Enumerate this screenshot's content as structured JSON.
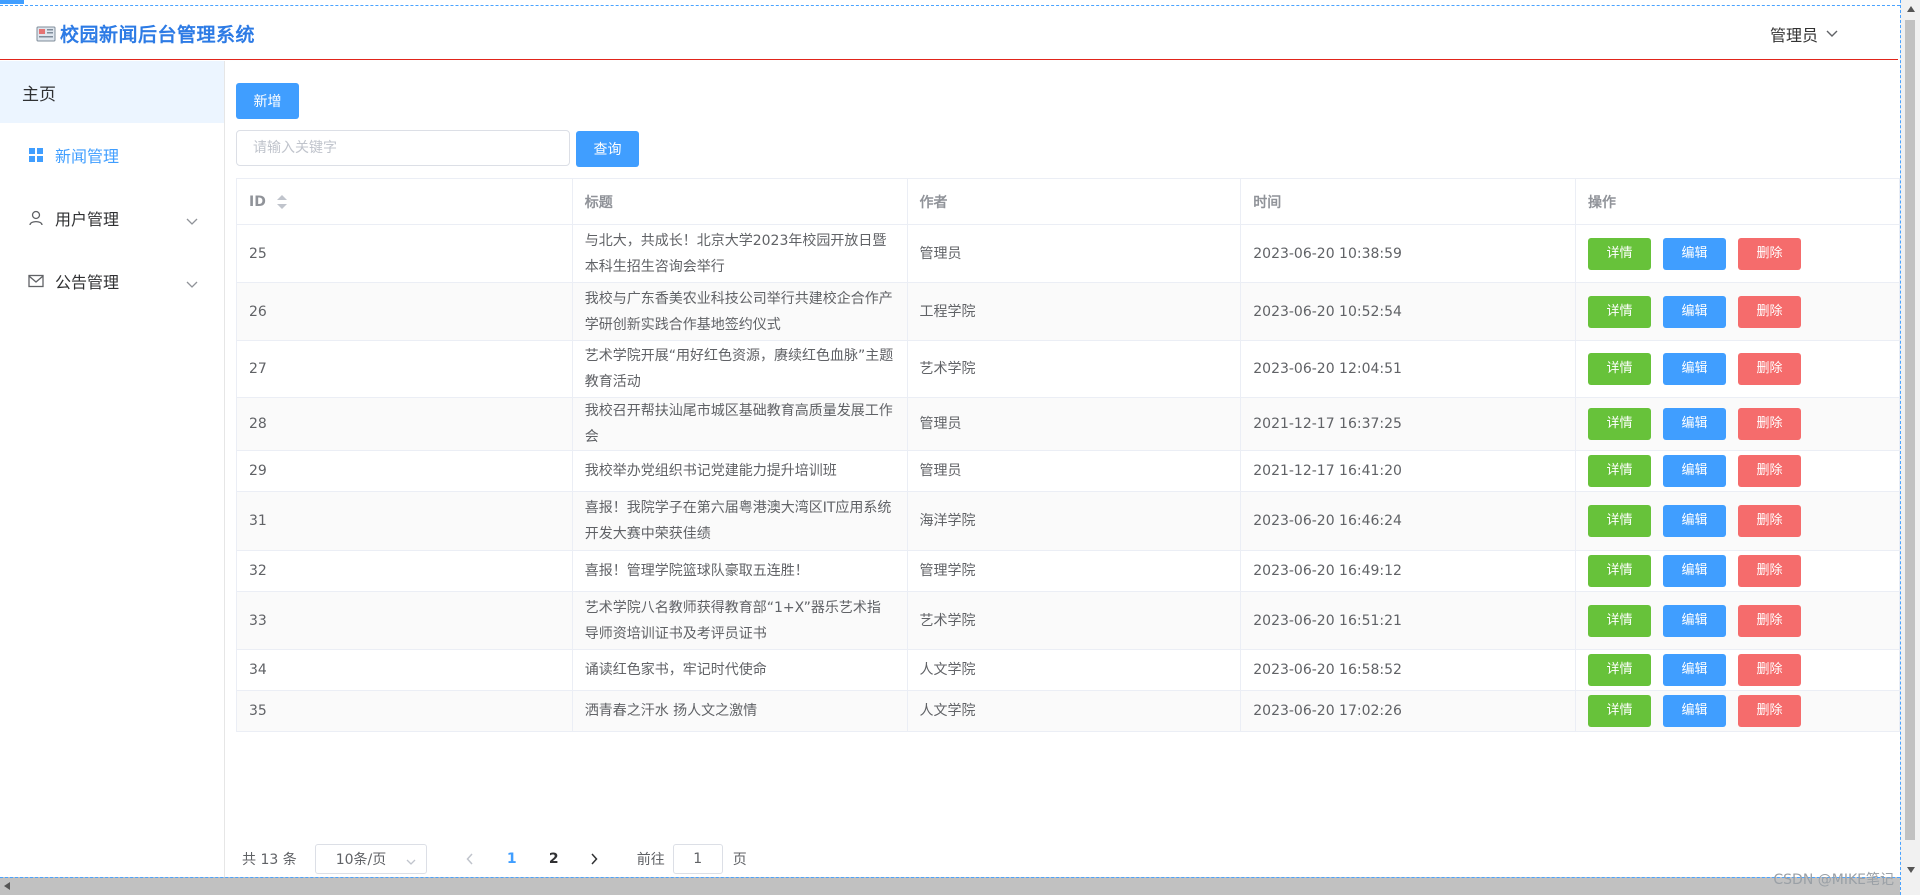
{
  "header": {
    "title": "校园新闻后台管理系统",
    "user": "管理员"
  },
  "sidebar": {
    "home": "主页",
    "items": [
      {
        "label": "新闻管理",
        "icon": "grid-icon",
        "active": true
      },
      {
        "label": "用户管理",
        "icon": "user-icon",
        "active": false
      },
      {
        "label": "公告管理",
        "icon": "mail-icon",
        "active": false
      }
    ]
  },
  "toolbar": {
    "add_label": "新增",
    "search_placeholder": "请输入关键字",
    "query_label": "查询"
  },
  "table": {
    "columns": [
      "ID",
      "标题",
      "作者",
      "时间",
      "操作"
    ],
    "action_labels": {
      "detail": "详情",
      "edit": "编辑",
      "delete": "删除"
    },
    "rows": [
      {
        "id": "25",
        "title": "与北大，共成长！北京大学2023年校园开放日暨本科生招生咨询会举行",
        "author": "管理员",
        "time": "2023-06-20 10:38:59"
      },
      {
        "id": "26",
        "title": "我校与广东香美农业科技公司举行共建校企合作产学研创新实践合作基地签约仪式",
        "author": "工程学院",
        "time": "2023-06-20 10:52:54"
      },
      {
        "id": "27",
        "title": "艺术学院开展“用好红色资源，赓续红色血脉”主题教育活动",
        "author": "艺术学院",
        "time": "2023-06-20 12:04:51"
      },
      {
        "id": "28",
        "title": "我校召开帮扶汕尾市城区基础教育高质量发展工作会",
        "author": "管理员",
        "time": "2021-12-17 16:37:25"
      },
      {
        "id": "29",
        "title": "我校举办党组织书记党建能力提升培训班",
        "author": "管理员",
        "time": "2021-12-17 16:41:20"
      },
      {
        "id": "31",
        "title": "喜报！我院学子在第六届粤港澳大湾区IT应用系统开发大赛中荣获佳绩",
        "author": "海洋学院",
        "time": "2023-06-20 16:46:24"
      },
      {
        "id": "32",
        "title": "喜报！管理学院篮球队豪取五连胜！",
        "author": "管理学院",
        "time": "2023-06-20 16:49:12"
      },
      {
        "id": "33",
        "title": "艺术学院八名教师获得教育部“1+X”器乐艺术指导师资培训证书及考评员证书",
        "author": "艺术学院",
        "time": "2023-06-20 16:51:21"
      },
      {
        "id": "34",
        "title": "诵读红色家书，牢记时代使命",
        "author": "人文学院",
        "time": "2023-06-20 16:58:52"
      },
      {
        "id": "35",
        "title": "洒青春之汗水 扬人文之激情",
        "author": "人文学院",
        "time": "2023-06-20 17:02:26"
      }
    ]
  },
  "pagination": {
    "total": "共 13 条",
    "page_size": "10条/页",
    "pages": [
      "1",
      "2"
    ],
    "current_page": "1",
    "goto_label": "前往",
    "goto_value": "1",
    "page_suffix": "页"
  },
  "watermark": "CSDN @MIKE笔记",
  "colors": {
    "primary": "#409eff",
    "success": "#67c23a",
    "danger": "#f56c6c",
    "header_line": "#e1251b"
  }
}
